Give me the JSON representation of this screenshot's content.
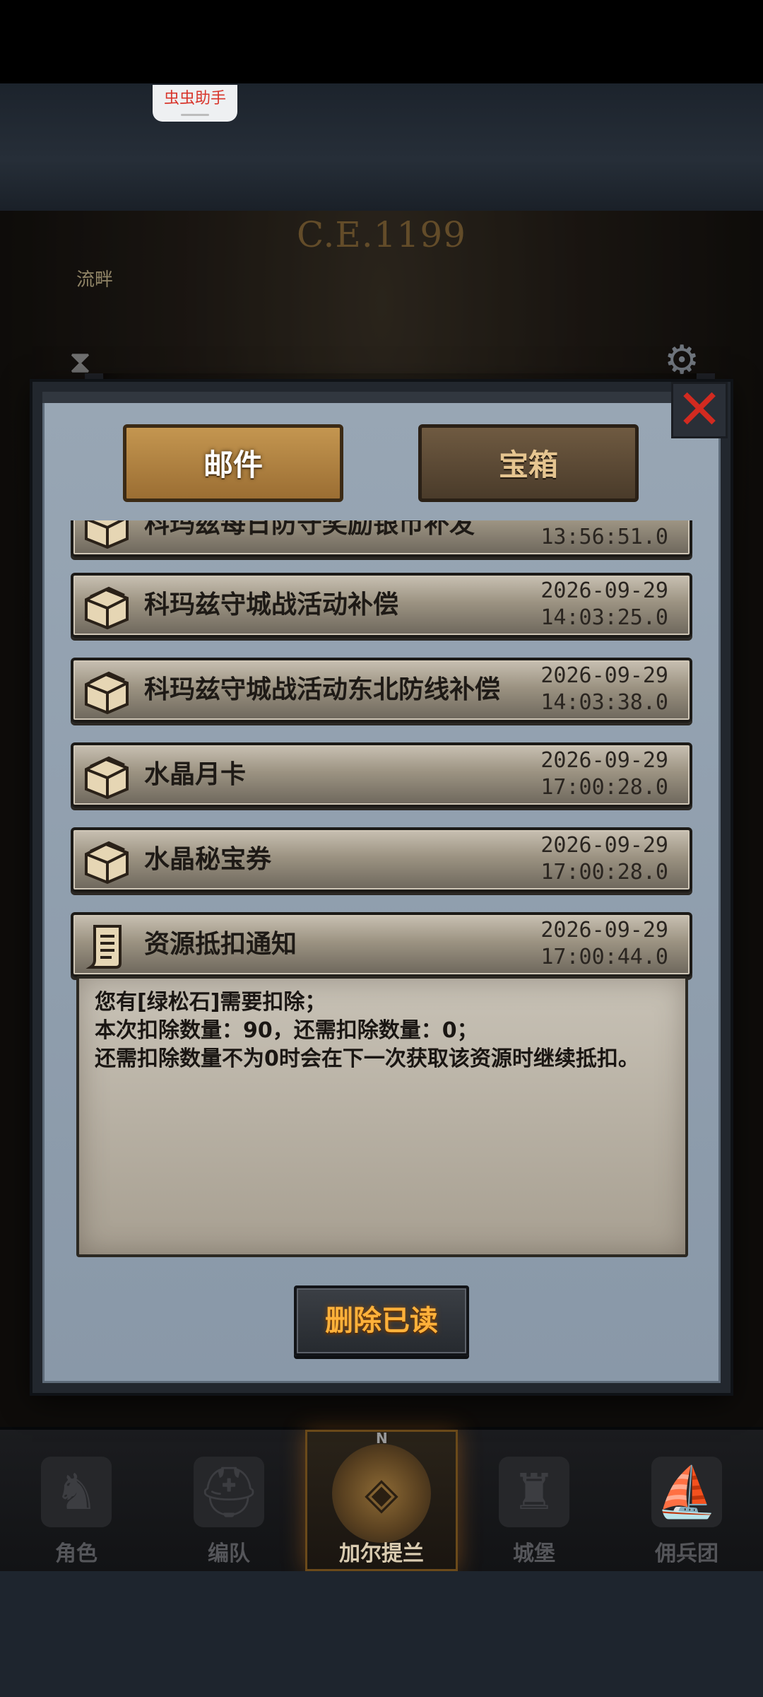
{
  "status": {
    "assistant_tag": "虫虫助手"
  },
  "background": {
    "year": "C.E.1199",
    "side_label": "流畔",
    "hourglass_icon": "hourglass-icon",
    "settings_icon": "gear-icon"
  },
  "tabs": [
    {
      "label": "邮件",
      "active": true
    },
    {
      "label": "宝箱",
      "active": false
    }
  ],
  "mails": [
    {
      "title": "科玛兹每日防守奖励银币补发",
      "date": "",
      "time": "13:56:51.0",
      "icon": "chest-icon"
    },
    {
      "title": "科玛兹守城战活动补偿",
      "date": "2026-09-29",
      "time": "14:03:25.0",
      "icon": "chest-icon"
    },
    {
      "title": "科玛兹守城战活动东北防线补偿",
      "date": "2026-09-29",
      "time": "14:03:38.0",
      "icon": "chest-icon"
    },
    {
      "title": "水晶月卡",
      "date": "2026-09-29",
      "time": "17:00:28.0",
      "icon": "chest-icon"
    },
    {
      "title": "水晶秘宝券",
      "date": "2026-09-29",
      "time": "17:00:28.0",
      "icon": "chest-icon"
    },
    {
      "title": "资源抵扣通知",
      "date": "2026-09-29",
      "time": "17:00:44.0",
      "icon": "scroll-icon"
    }
  ],
  "message": {
    "lines": [
      "您有[绿松石]需要扣除；",
      "本次扣除数量：90，还需扣除数量：0；",
      "还需扣除数量不为0时会在下一次获取该资源时继续抵扣。"
    ]
  },
  "delete_read_label": "删除已读",
  "nav": [
    {
      "label": "角色",
      "icon": "knight-icon",
      "active": false
    },
    {
      "label": "编队",
      "icon": "helmet-icon",
      "active": false
    },
    {
      "label": "加尔提兰",
      "icon": "compass-map-icon",
      "active": true,
      "compass_letter": "N"
    },
    {
      "label": "城堡",
      "icon": "castle-icon",
      "active": false
    },
    {
      "label": "佣兵团",
      "icon": "ship-icon",
      "active": false
    }
  ],
  "colors": {
    "accent_orange": "#ffb13a",
    "close_red": "#d22a20",
    "panel_blue": "#98a6b4",
    "parchment": "#c8c0b2"
  }
}
